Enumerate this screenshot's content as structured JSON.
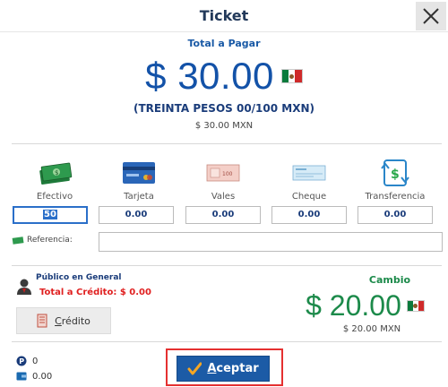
{
  "window": {
    "title": "Ticket",
    "close_label": "×"
  },
  "total": {
    "label": "Total a Pagar",
    "amount": "$ 30.00",
    "amount_words": "(TREINTA PESOS 00/100 MXN)",
    "amount_small": "$ 30.00 MXN",
    "flag_icon": "mexico-flag-icon"
  },
  "payment_methods": [
    {
      "label": "Efectivo",
      "value": "50",
      "icon": "cash-icon"
    },
    {
      "label": "Tarjeta",
      "value": "0.00",
      "icon": "credit-card-icon"
    },
    {
      "label": "Vales",
      "value": "0.00",
      "icon": "voucher-icon"
    },
    {
      "label": "Cheque",
      "value": "0.00",
      "icon": "check-icon"
    },
    {
      "label": "Transferencia",
      "value": "0.00",
      "icon": "transfer-icon"
    }
  ],
  "reference": {
    "label": "Referencia:",
    "value": "",
    "icon": "cash-icon"
  },
  "client": {
    "name": "Público en General",
    "credit_total_label": "Total a Crédito:",
    "credit_total_value": "$ 0.00",
    "icon": "person-icon"
  },
  "credit_button": {
    "label_before": "",
    "label_underlined": "C",
    "label_after": "rédito",
    "icon": "document-icon"
  },
  "change": {
    "label": "Cambio",
    "amount": "$ 20.00",
    "amount_small": "$ 20.00 MXN"
  },
  "balances": [
    {
      "icon": "points-icon",
      "value": "0"
    },
    {
      "icon": "wallet-icon",
      "value": "0.00"
    }
  ],
  "accept_button": {
    "label_underlined": "A",
    "label_after": "ceptar",
    "icon": "checkmark-icon"
  },
  "colors": {
    "title": "#22395a",
    "total_blue": "#1352a8",
    "change_green": "#1c8a4a",
    "credit_red": "#e02020",
    "accept_bg": "#1c5ba6",
    "highlight_red": "#e53030"
  }
}
